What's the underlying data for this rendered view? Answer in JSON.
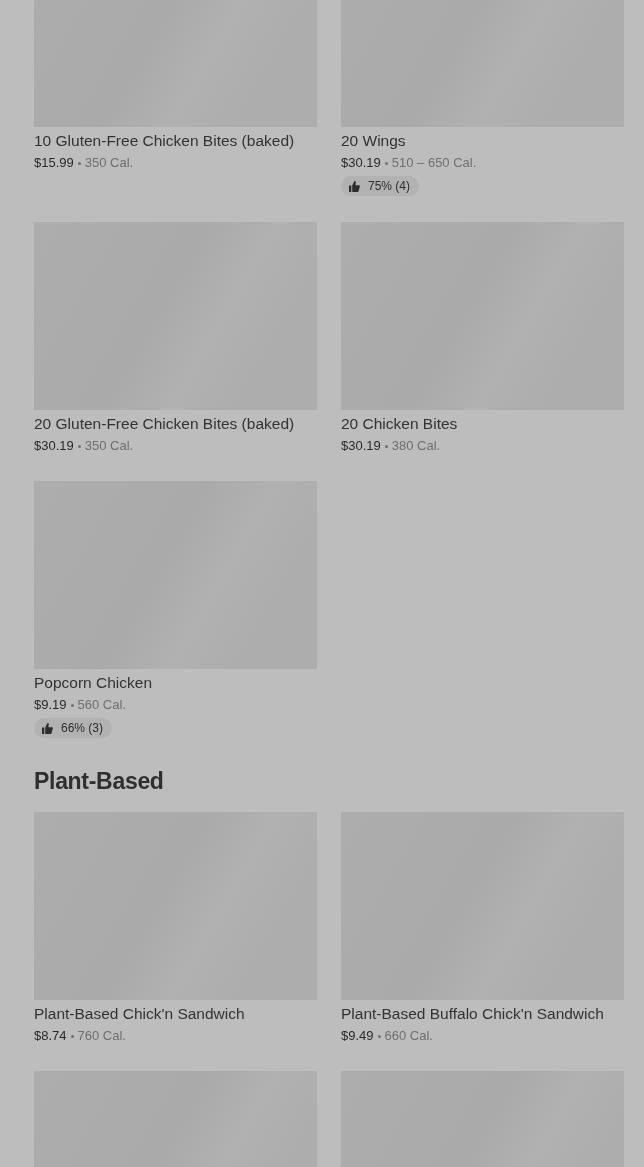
{
  "sections": [
    {
      "items": [
        {
          "kind": "item",
          "name": "10 Gluten-Free Chicken Bites (baked)",
          "price": "$15.99",
          "calories": "350 Cal."
        },
        {
          "kind": "item",
          "name": "20 Wings",
          "price": "$30.19",
          "calories": "510 – 650 Cal.",
          "rating": "75% (4)"
        },
        {
          "kind": "item",
          "name": "20 Gluten-Free Chicken Bites (baked)",
          "price": "$30.19",
          "calories": "350 Cal."
        },
        {
          "kind": "item",
          "name": "20 Chicken Bites",
          "price": "$30.19",
          "calories": "380 Cal."
        },
        {
          "kind": "item",
          "name": "Popcorn Chicken",
          "price": "$9.19",
          "calories": "560 Cal.",
          "rating": "66% (3)"
        }
      ]
    },
    {
      "title": "Plant-Based",
      "items": [
        {
          "kind": "item",
          "name": "Plant-Based Chick'n Sandwich",
          "price": "$8.74",
          "calories": "760 Cal."
        },
        {
          "kind": "item",
          "name": "Plant-Based Buffalo Chick'n Sandwich",
          "price": "$9.49",
          "calories": "660 Cal."
        },
        {
          "kind": "image-only"
        },
        {
          "kind": "image-only"
        }
      ]
    }
  ]
}
